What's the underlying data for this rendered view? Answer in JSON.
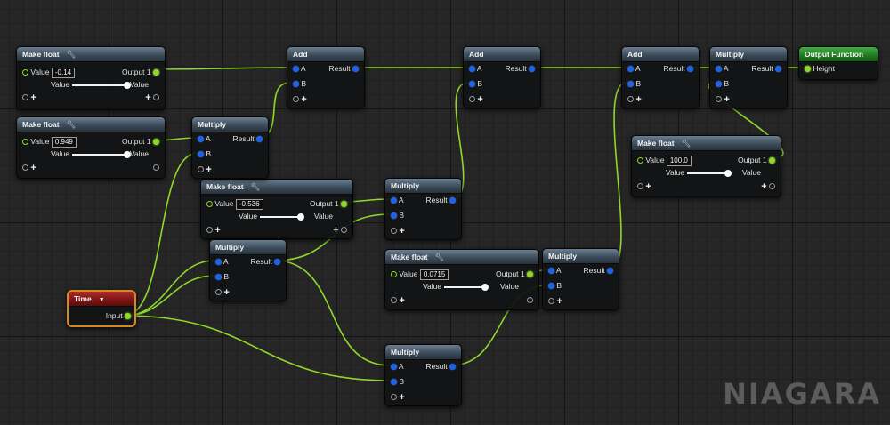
{
  "graph": {
    "watermark": "NIAGARA",
    "colors": {
      "wire": "#8fd82a",
      "float_pin": "#1f62e6",
      "output_header": "#2a8f2a",
      "time_header": "#8c1c1c",
      "time_border": "#d6891f"
    }
  },
  "nodes": {
    "make_float_1": {
      "title": "Make float",
      "value_label": "Value",
      "value": "-0.14",
      "output_label": "Output 1",
      "sub_value_label": "Value",
      "sub_value_right": "Value"
    },
    "make_float_2": {
      "title": "Make float",
      "value_label": "Value",
      "value": "0.949",
      "output_label": "Output 1",
      "sub_value_label": "Value",
      "sub_value_right": "Value"
    },
    "make_float_3": {
      "title": "Make float",
      "value_label": "Value",
      "value": "-0.536",
      "output_label": "Output 1",
      "sub_value_label": "Value",
      "sub_value_right": "Value"
    },
    "make_float_4": {
      "title": "Make float",
      "value_label": "Value",
      "value": "0.0715",
      "output_label": "Output 1",
      "sub_value_label": "Value",
      "sub_value_right": "Value"
    },
    "make_float_5": {
      "title": "Make float",
      "value_label": "Value",
      "value": "100.0",
      "output_label": "Output 1",
      "sub_value_label": "Value",
      "sub_value_right": "Value"
    },
    "add_1": {
      "title": "Add",
      "a": "A",
      "b": "B",
      "result": "Result"
    },
    "add_2": {
      "title": "Add",
      "a": "A",
      "b": "B",
      "result": "Result"
    },
    "add_3": {
      "title": "Add",
      "a": "A",
      "b": "B",
      "result": "Result"
    },
    "multiply_1": {
      "title": "Multiply",
      "a": "A",
      "b": "B",
      "result": "Result"
    },
    "multiply_2": {
      "title": "Multiply",
      "a": "A",
      "b": "B",
      "result": "Result"
    },
    "multiply_3": {
      "title": "Multiply",
      "a": "A",
      "b": "B",
      "result": "Result"
    },
    "multiply_4": {
      "title": "Multiply",
      "a": "A",
      "b": "B",
      "result": "Result"
    },
    "multiply_5": {
      "title": "Multiply",
      "a": "A",
      "b": "B",
      "result": "Result"
    },
    "multiply_6": {
      "title": "Multiply",
      "a": "A",
      "b": "B",
      "result": "Result"
    },
    "time": {
      "title": "Time",
      "caret": "▼",
      "input_label": "Input"
    },
    "output_function": {
      "title": "Output Function",
      "height_label": "Height"
    }
  },
  "icons": {
    "wrench": "wrench-icon",
    "add_pin": "plus-icon",
    "exec_pin": "exec-pin-icon",
    "dropdown": "dropdown-caret-icon"
  }
}
